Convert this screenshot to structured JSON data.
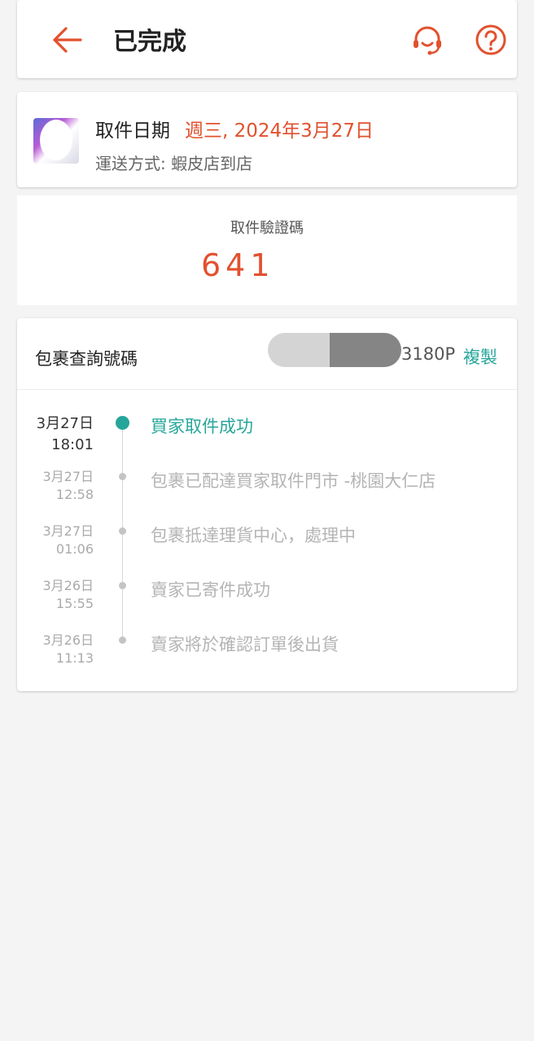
{
  "header": {
    "title": "已完成",
    "back_icon": "back-arrow-icon",
    "support_icon": "headset-icon",
    "help_icon": "help-circle-icon",
    "accent": "#e2512e"
  },
  "pickup": {
    "date_label": "取件日期",
    "date_value": "週三, 2024年3月27日",
    "shipping_method": "運送方式: 蝦皮店到店"
  },
  "verification": {
    "label": "取件驗證碼",
    "code": "641"
  },
  "tracking": {
    "label": "包裹查詢號碼",
    "number_suffix": "3180P",
    "copy_label": "複製",
    "events": [
      {
        "date": "3月27日",
        "time": "18:01",
        "text": "買家取件成功",
        "active": true
      },
      {
        "date": "3月27日",
        "time": "12:58",
        "text": "包裹已配達買家取件門市  -桃園大仁店",
        "active": false
      },
      {
        "date": "3月27日",
        "time": "01:06",
        "text": "包裹抵達理貨中心，處理中",
        "active": false
      },
      {
        "date": "3月26日",
        "time": "15:55",
        "text": "賣家已寄件成功",
        "active": false
      },
      {
        "date": "3月26日",
        "time": "11:13",
        "text": "賣家將於確認訂單後出貨",
        "active": false
      }
    ],
    "active_color": "#26a69a"
  }
}
